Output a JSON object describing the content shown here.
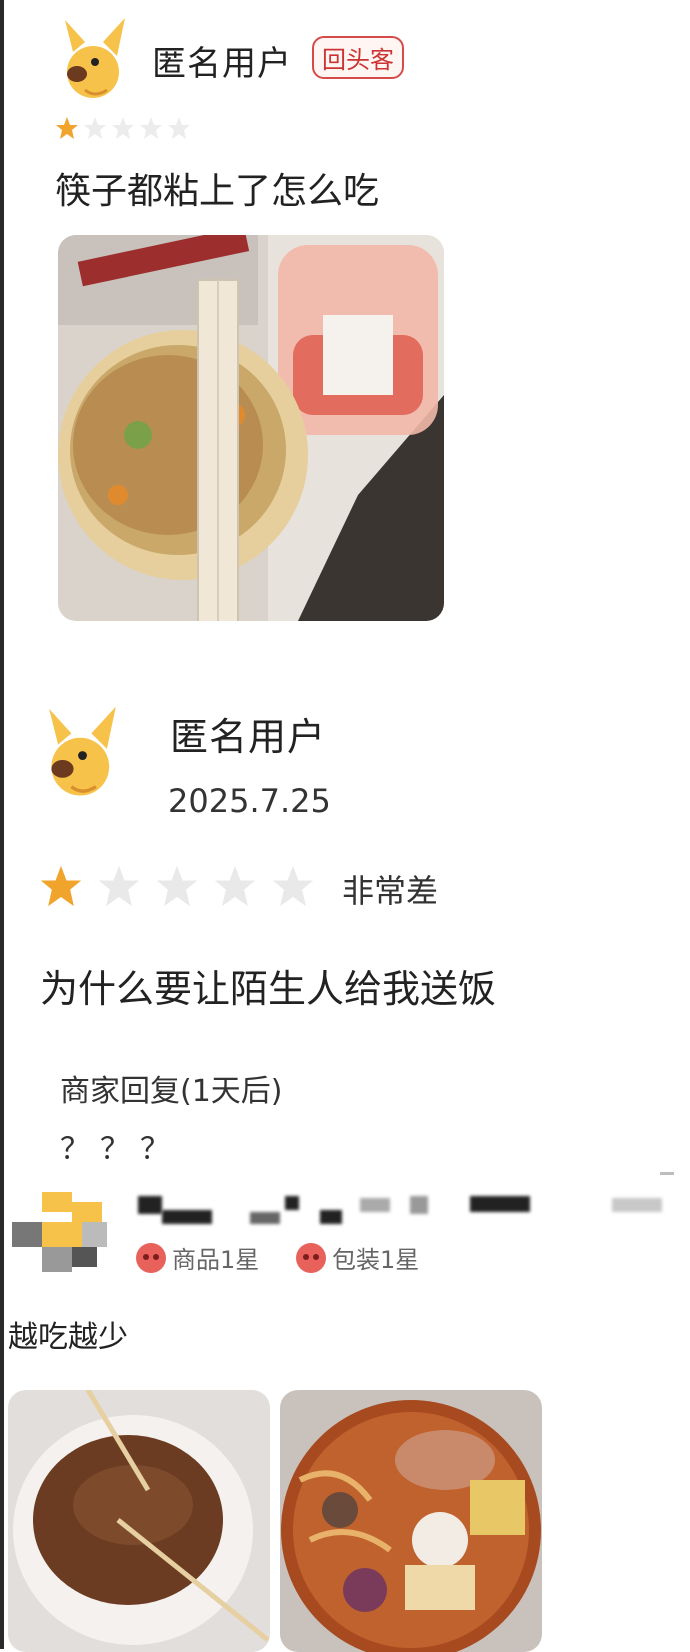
{
  "review1": {
    "username": "匿名用户",
    "badge": "回头客",
    "rating": 1,
    "text": "筷子都粘上了怎么吃"
  },
  "review2": {
    "username": "匿名用户",
    "date": "2025.7.25",
    "rating": 1,
    "rating_word": "非常差",
    "text": "为什么要让陌生人给我送饭",
    "reply_title": "商家回复(1天后)",
    "reply_body": "？？？"
  },
  "review3": {
    "tag1": "商品1星",
    "tag2": "包装1星",
    "text": "越吃越少"
  },
  "colors": {
    "star_on": "#f1a42b",
    "star_off": "#e6e6e6",
    "badge": "#d64a4a"
  },
  "icons": [
    "dog-avatar-icon",
    "star-icon",
    "angry-face-icon"
  ]
}
